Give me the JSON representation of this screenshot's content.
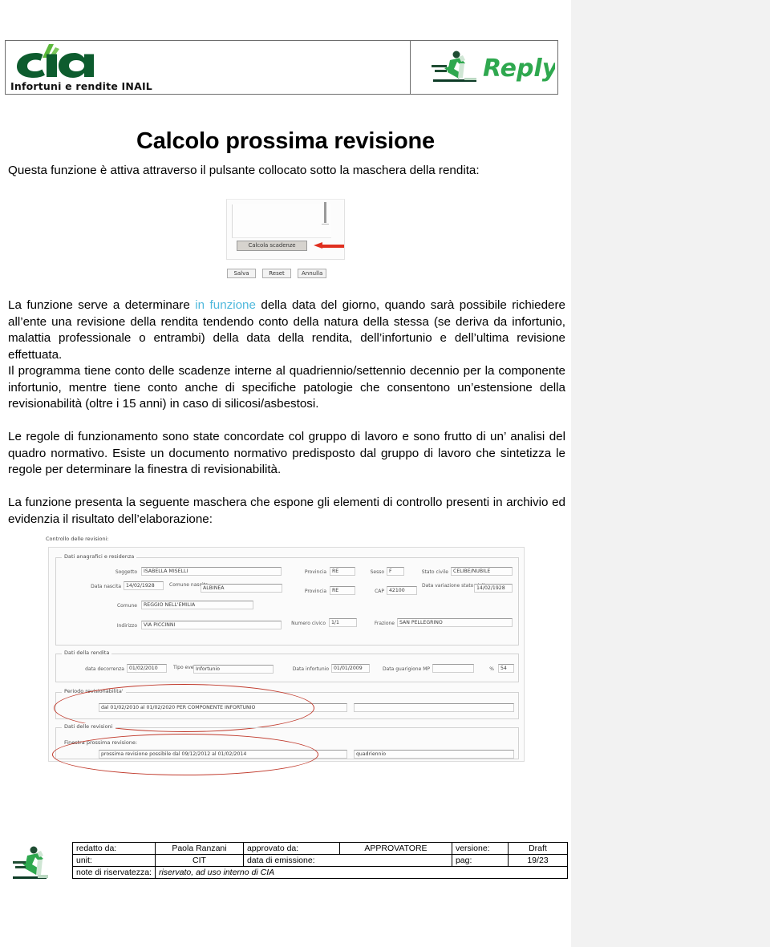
{
  "header": {
    "brand_logo_name": "cia-logo",
    "brand_caption": "Infortuni e rendite INAIL",
    "partner_logo_name": "reply-logo",
    "partner_text": "Reply"
  },
  "title": "Calcolo prossima revisione",
  "intro": {
    "line": "Questa funzione è attiva attraverso il pulsante collocato sotto la maschera della rendita:"
  },
  "figure1": {
    "calc_button": "Calcola scadenze",
    "save_button": "Salva",
    "reset_button": "Reset",
    "cancel_button": "Annulla",
    "arrow_color": "#e03020"
  },
  "paragraphs": {
    "p1_a": "La funzione serve a determinare ",
    "p1_highlight": "in funzione",
    "p1_highlight_color": "#4fb8dc",
    "p1_b": " della data del giorno, quando sarà possibile richiedere all’ente una revisione della rendita tendendo conto della natura della stessa (se deriva da infortunio, malattia professionale o entrambi) della data della rendita, dell’infortunio e dell’ultima revisione effettuata.",
    "p2": "Il programma tiene conto delle scadenze interne al quadriennio/settennio decennio per la componente infortunio, mentre tiene conto anche di specifiche patologie che consentono un’estensione della revisionabilità (oltre i 15 anni) in caso di silicosi/asbestosi.",
    "p3": "Le regole di funzionamento sono state concordate col gruppo di lavoro e sono frutto di un’ analisi del quadro normativo. Esiste un documento normativo predisposto dal gruppo di lavoro che sintetizza le regole per determinare la finestra di revisionabilità.",
    "p4": "La funzione presenta la seguente maschera che espone gli elementi di controllo presenti in archivio ed evidenzia il risultato dell’elaborazione:"
  },
  "figure2": {
    "caption": "Controllo delle revisioni:",
    "group_anagrafici": "Dati anagrafici e residenza",
    "group_rendita": "Dati della rendita",
    "group_periodo": "Periodo revisionabilita'",
    "group_revisioni": "Dati delle revisioni",
    "group_finestra": "Finestra prossima revisione:",
    "labels": {
      "soggetto": "Soggetto",
      "data_nascita": "Data nascita",
      "comune_nascita": "Comune nascita",
      "comune": "Comune",
      "indirizzo": "Indirizzo",
      "provincia1": "Provincia",
      "provincia2": "Provincia",
      "sesso": "Sesso",
      "stato_civile": "Stato civile",
      "cap": "CAP",
      "data_variazione": "Data variazione stato civile",
      "numero_civico": "Numero civico",
      "frazione": "Frazione",
      "data_decorrenza": "data decorrenza",
      "tipo_eventi": "Tipo eventi",
      "data_infortunio": "Data infortunio",
      "data_guarigione": "Data guarigione MP",
      "percento": "%"
    },
    "values": {
      "soggetto": "ISABELLA MISELLI",
      "data_nascita": "14/02/1928",
      "comune_nascita": "ALBINEA",
      "comune": "REGGIO NELL'EMILIA",
      "indirizzo": "VIA PICCINNI",
      "provincia1": "RE",
      "provincia2": "RE",
      "sesso": "F",
      "stato_civile": "CELIBE/NUBILE",
      "cap": "42100",
      "data_variazione": "14/02/1928",
      "numero_civico": "1/1",
      "frazione": "SAN PELLEGRINO",
      "data_decorrenza": "01/02/2010",
      "tipo_eventi": "Infortunio",
      "data_infortunio": "01/01/2009",
      "data_guarigione": "",
      "percento": "54",
      "periodo_revisionabilita": "dal 01/02/2010 al 01/02/2020 PER COMPONENTE INFORTUNIO",
      "periodo_extra": "",
      "finestra_prossima": "prossima revisione possibile dal 09/12/2012 al 01/02/2014",
      "finestra_tipo": "quadriennio"
    },
    "highlight_color": "#c0392b"
  },
  "footer": {
    "runner_icon_name": "runner-icon",
    "rows": [
      {
        "c1": "redatto da:",
        "c2": "Paola Ranzani",
        "c3": "approvato da:",
        "c4": "APPROVATORE",
        "c5": "versione:",
        "c6": "Draft"
      },
      {
        "c1": "unit:",
        "c2": "CIT",
        "c3": "data di emissione:",
        "c4": "",
        "c5": "pag:",
        "c6": "19/23"
      }
    ],
    "note_label": "note di riservatezza:",
    "note_value": "riservato, ad uso interno di CIA"
  }
}
